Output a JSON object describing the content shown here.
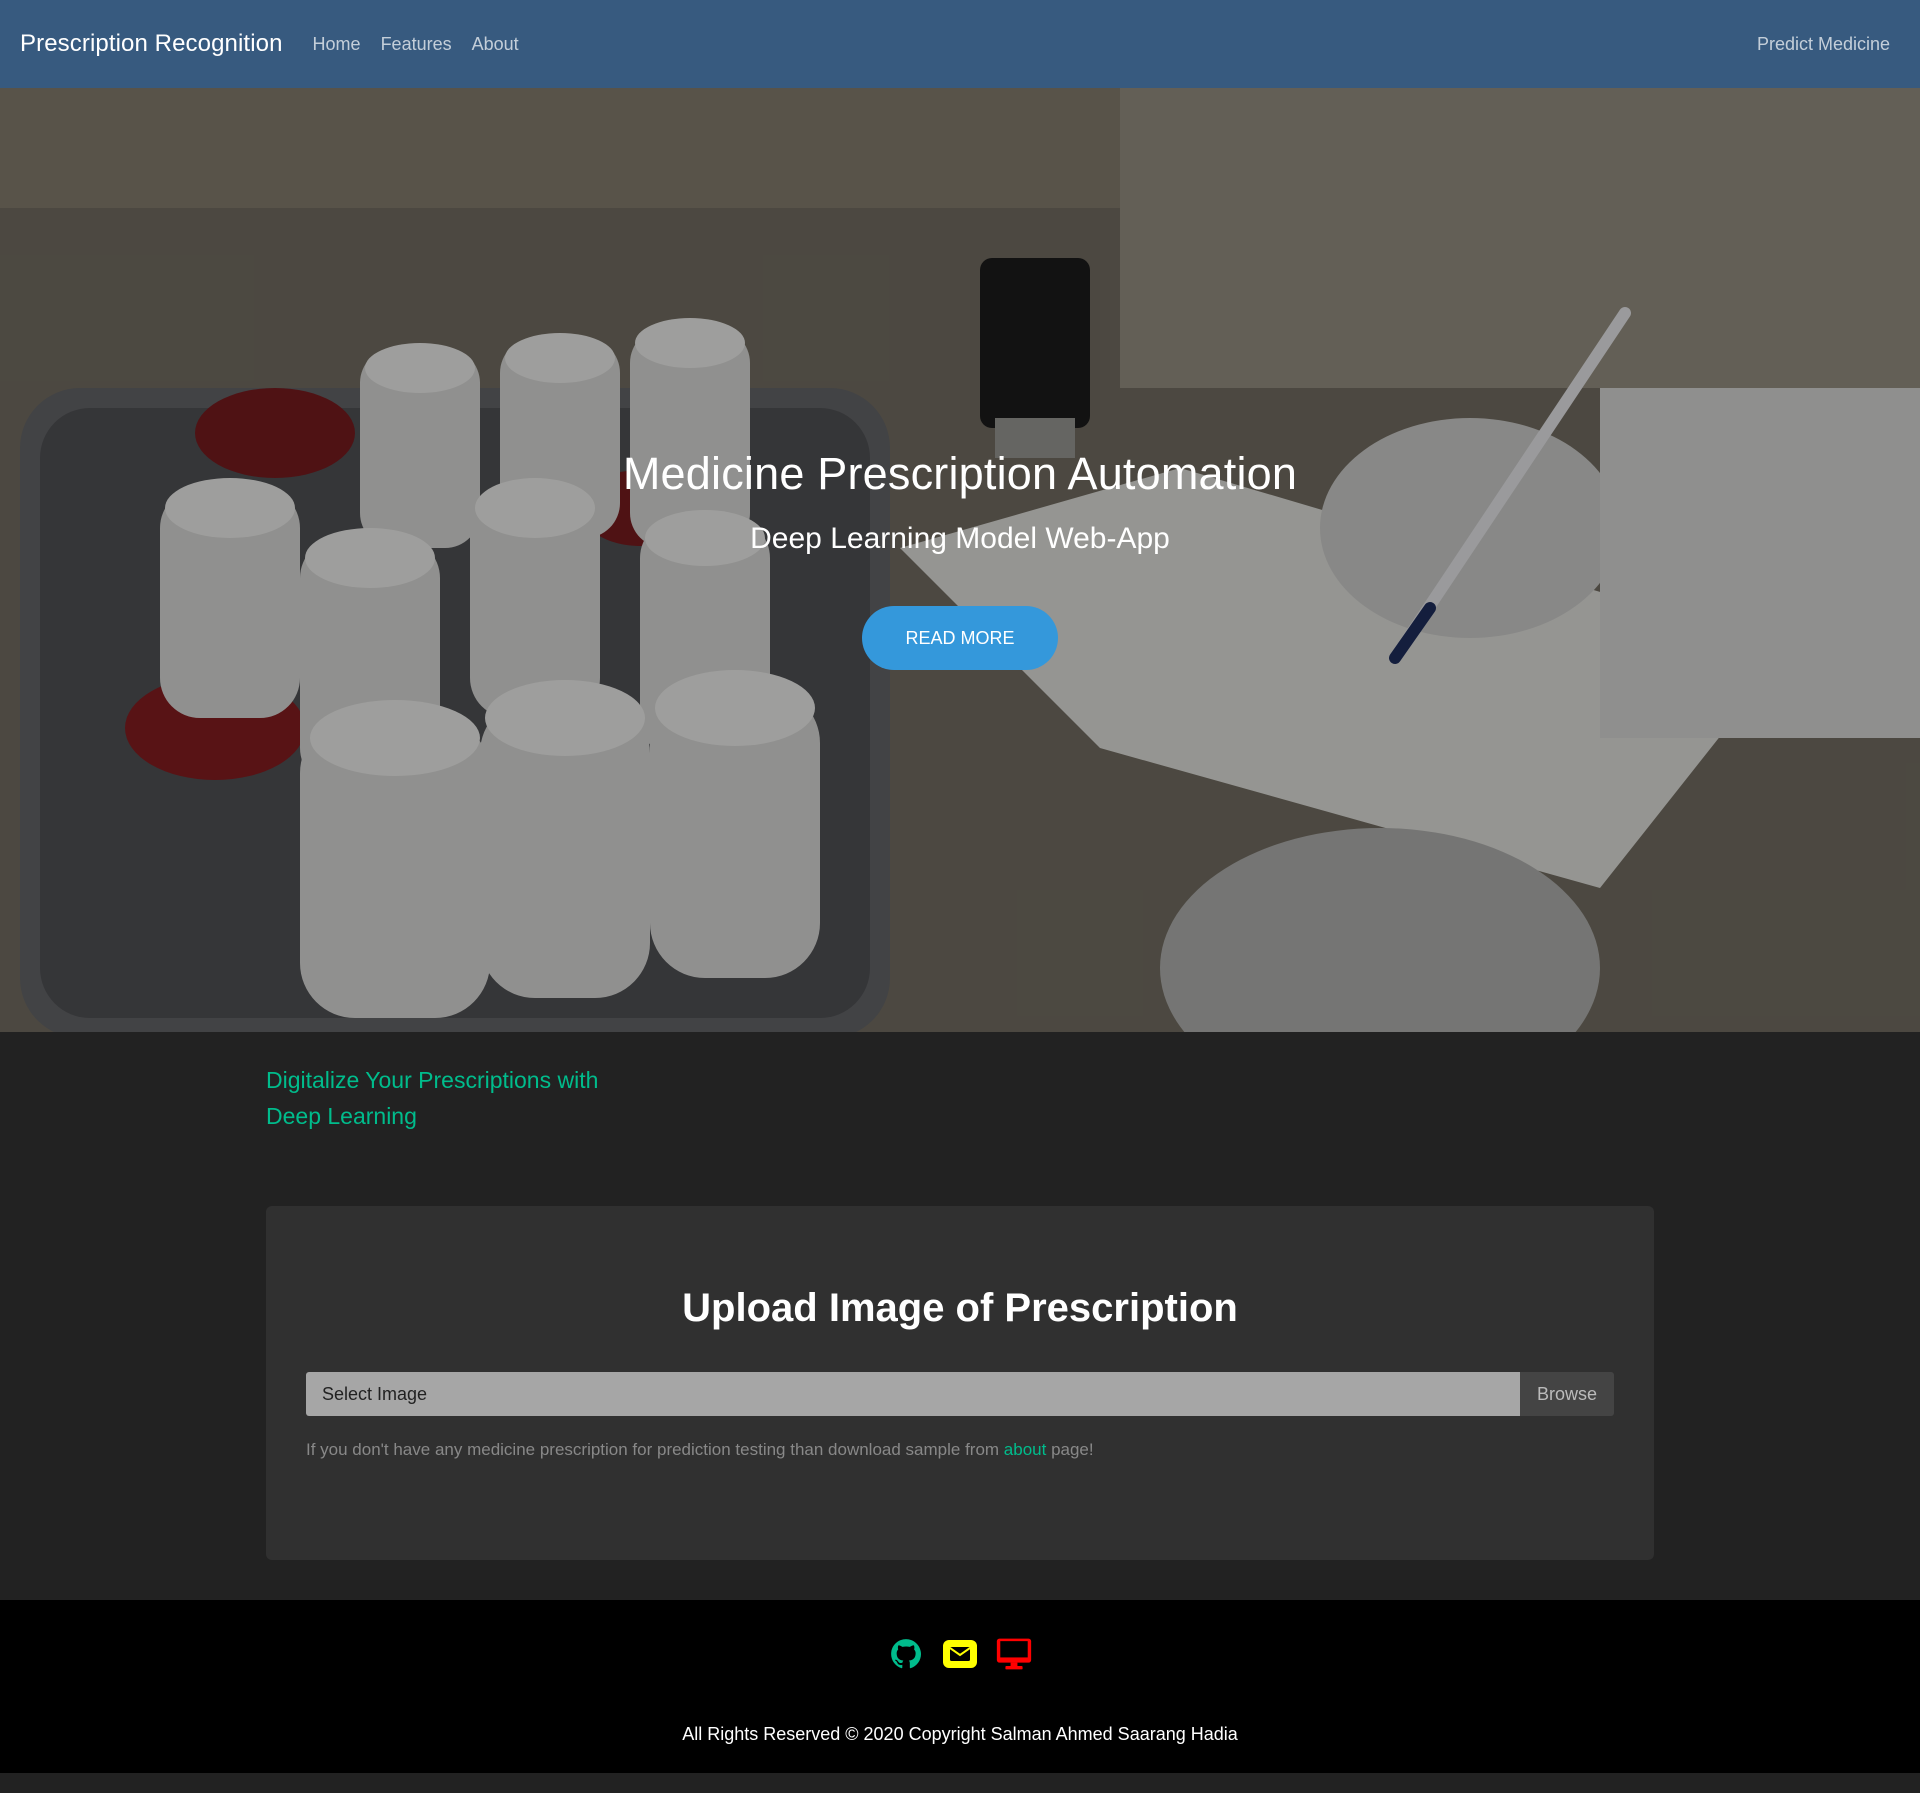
{
  "navbar": {
    "brand": "Prescription Recognition",
    "links": [
      "Home",
      "Features",
      "About"
    ],
    "right_link": "Predict Medicine",
    "bg_color": "#375a7f"
  },
  "hero": {
    "title": "Medicine Prescription Automation",
    "subtitle": "Deep Learning Model Web-App",
    "button_label": "READ MORE",
    "button_color": "#3498db"
  },
  "main": {
    "tagline": "Digitalize Your Prescriptions with Deep Learning",
    "tagline_color": "#00bc8c",
    "upload": {
      "title": "Upload Image of Prescription",
      "file_placeholder": "Select Image",
      "browse_label": "Browse",
      "help_text_before": "If you don't have any medicine prescription for prediction testing than download sample from ",
      "help_link": "about",
      "help_text_after": " page!"
    }
  },
  "footer": {
    "icons": [
      "github-icon",
      "mail-icon",
      "monitor-icon"
    ],
    "icon_colors": [
      "#00bc8c",
      "#ffff00",
      "#ff0000"
    ],
    "copyright": "All Rights Reserved © 2020 Copyright Salman Ahmed Saarang Hadia"
  }
}
